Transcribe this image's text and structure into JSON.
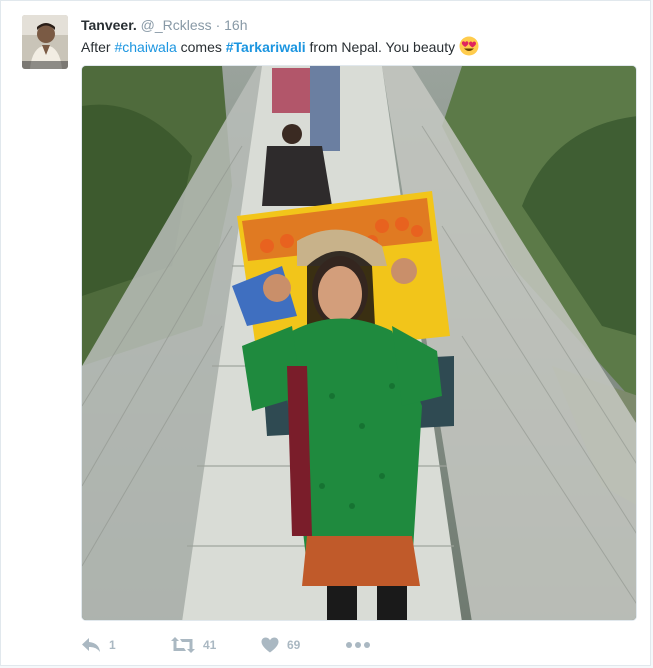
{
  "tweet": {
    "author_name": "Tanveer.",
    "author_handle": "@_Rckless",
    "separator": "·",
    "timestamp": "16h",
    "text_parts": {
      "t1": "After ",
      "h1": "#chaiwala",
      "t2": " comes ",
      "h2": "#Tarkariwali",
      "t3": " from Nepal. You beauty"
    },
    "emoji_icon": "heart-eyes-emoji-icon",
    "media_description_icon": "photo",
    "actions": {
      "reply": {
        "icon": "reply-icon",
        "count": "1"
      },
      "retweet": {
        "icon": "retweet-icon",
        "count": "41"
      },
      "like": {
        "icon": "heart-icon",
        "count": "69"
      },
      "more": {
        "icon": "more-dots-icon"
      }
    }
  },
  "colors": {
    "link": "#1b95e0",
    "text": "#292f33",
    "muted": "#8899a6",
    "action_gray": "#aab8c2",
    "border": "#e1e8ed"
  }
}
